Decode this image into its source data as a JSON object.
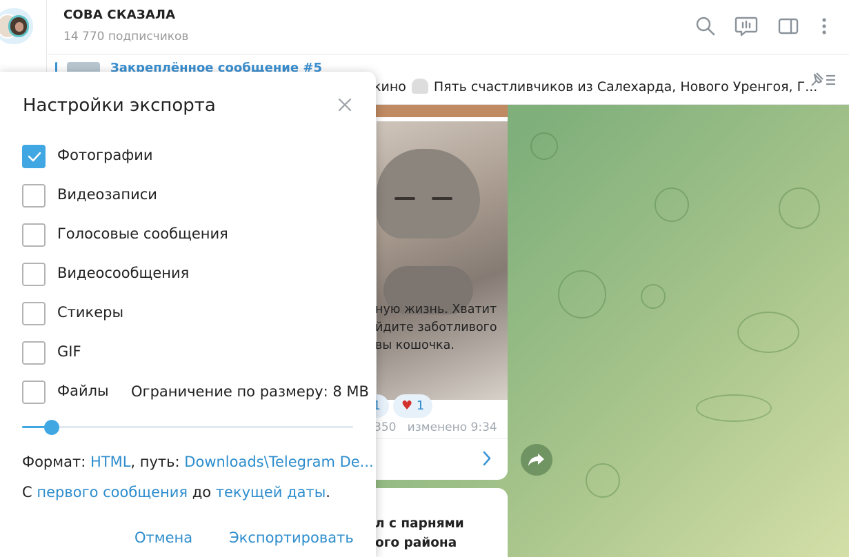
{
  "channel": {
    "title": "СОВА СКАЗАЛА",
    "subscribers": "14 770 подписчиков"
  },
  "header_icons": [
    "search-icon",
    "live-chat-icon",
    "sidebar-toggle-icon",
    "more-vertical-icon"
  ],
  "pinned": {
    "title": "Закреплённое сообщение #5",
    "text_prefix": "кино",
    "text": "Пять счастливчиков из Салехарда, Нового Уренгоя, Г..."
  },
  "message": {
    "text_lines": [
      "ную жизнь. Хватит",
      "йдите заботливого",
      "вы кошочка."
    ],
    "reactions": [
      "1",
      "1"
    ],
    "views": "350",
    "edited_time": "изменено 9:34"
  },
  "message2": {
    "text_lines": [
      "л с парнями",
      "ого района"
    ]
  },
  "dialog": {
    "title": "Настройки экспорта",
    "options": [
      {
        "label": "Фотографии",
        "checked": true
      },
      {
        "label": "Видеозаписи",
        "checked": false
      },
      {
        "label": "Голосовые сообщения",
        "checked": false
      },
      {
        "label": "Видеосообщения",
        "checked": false
      },
      {
        "label": "Стикеры",
        "checked": false
      },
      {
        "label": "GIF",
        "checked": false
      },
      {
        "label": "Файлы",
        "checked": false
      }
    ],
    "size_limit": "Ограничение по размеру: 8 MB",
    "size_slider_fraction": 0.09,
    "format_label": "Формат:",
    "format_value": "HTML",
    "path_label": ", путь:",
    "path_value": "Downloads\\Telegram De...",
    "range_from_prefix": "С",
    "range_from": "первого сообщения",
    "range_mid": "до",
    "range_to": "текущей даты",
    "range_suffix": ".",
    "cancel_label": "Отмена",
    "export_label": "Экспортировать"
  },
  "colors": {
    "accent": "#40a7e3",
    "link": "#2d8dcd",
    "chat_bg": "#86b07b"
  }
}
